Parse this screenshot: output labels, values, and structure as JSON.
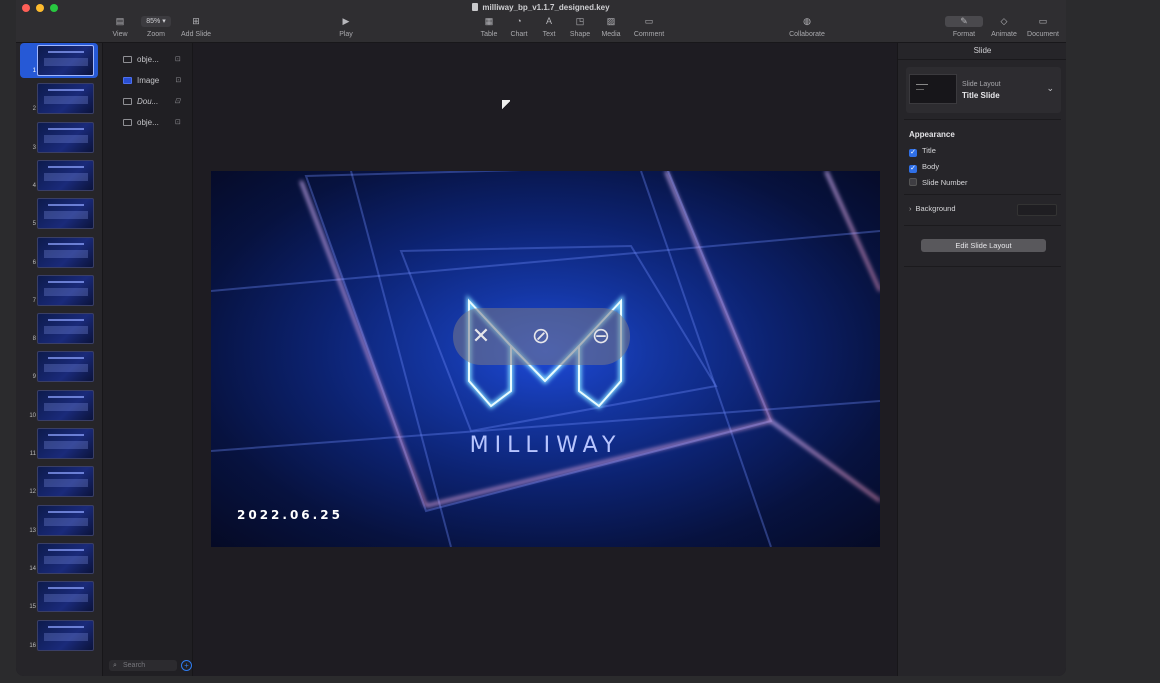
{
  "window": {
    "title": "milliway_bp_v1.1.7_designed.key",
    "traffic_colors": [
      "#ff5f57",
      "#febc2e",
      "#28c840"
    ]
  },
  "toolbar": {
    "view_label": "View",
    "zoom_value": "85%",
    "zoom_label": "Zoom",
    "add_slide_label": "Add Slide",
    "play_label": "Play",
    "table_label": "Table",
    "chart_label": "Chart",
    "text_label": "Text",
    "shape_label": "Shape",
    "media_label": "Media",
    "comment_label": "Comment",
    "collaborate_label": "Collaborate",
    "format_label": "Format",
    "animate_label": "Animate",
    "document_label": "Document"
  },
  "navigator": {
    "slide_numbers": [
      "1",
      "2",
      "3",
      "4",
      "5",
      "6",
      "7",
      "8",
      "9",
      "10",
      "11",
      "12",
      "13",
      "14",
      "15",
      "16"
    ],
    "selected": "1",
    "accent_color": "#2659d6"
  },
  "objects": {
    "items": [
      {
        "label": "obje..."
      },
      {
        "label": "Image"
      },
      {
        "label": "Dou..."
      },
      {
        "label": "obje..."
      }
    ],
    "search_placeholder": "Search"
  },
  "slide": {
    "brand_text": "MILLIWAY",
    "date_text": "2022.06.25",
    "hud_icons": [
      "pin-off-icon",
      "mute-icon",
      "minus-circle-icon"
    ]
  },
  "inspector": {
    "tab_title": "Slide",
    "layout_label": "Slide Layout",
    "layout_value": "Title Slide",
    "appearance_title": "Appearance",
    "checks": [
      {
        "label": "Title",
        "checked": true
      },
      {
        "label": "Body",
        "checked": true
      },
      {
        "label": "Slide Number",
        "checked": false
      }
    ],
    "background_label": "Background",
    "edit_button": "Edit Slide Layout"
  }
}
